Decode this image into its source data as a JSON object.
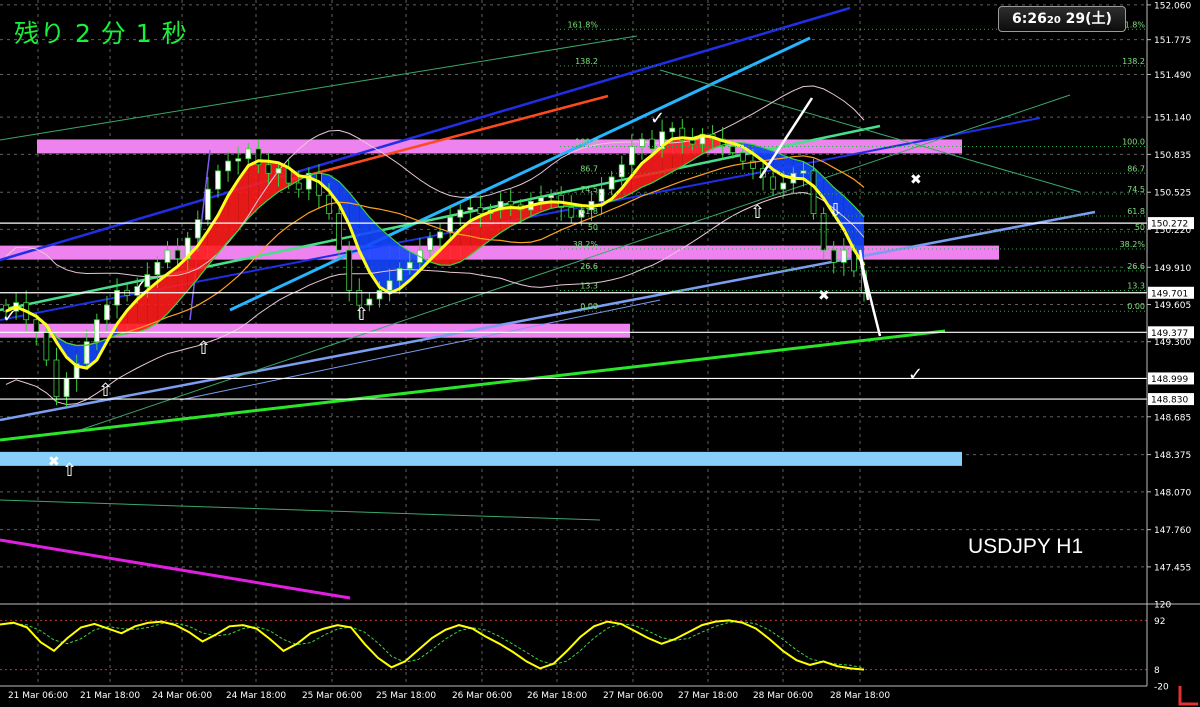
{
  "overlay": {
    "countdown": "残り 2 分 1 秒",
    "clock_time": "6:26",
    "clock_seconds": "20",
    "clock_date": "29(土)",
    "symbol_label": "USDJPY H1"
  },
  "colors": {
    "background": "#000000",
    "grid": "#5f5f5f",
    "candle_body": "#ffffff",
    "candle_wick": "#3cd23c",
    "cloud_bull": "#ff1c1c",
    "cloud_bear": "#1446ff",
    "sma_fast": "#ffff1e",
    "oscillator": "#ffff00",
    "zone_pink": "#ee82ee",
    "zone_blue": "#87cefa",
    "countdown_text": "#19f03c"
  },
  "chart_data": [
    {
      "type": "candlestick",
      "symbol": "USDJPY",
      "timeframe": "H1",
      "ylim": [
        147.2,
        152.1
      ],
      "y_ticks": [
        "152.060",
        "151.775",
        "151.490",
        "151.140",
        "150.835",
        "150.525",
        "150.220",
        "149.910",
        "149.605",
        "149.300",
        "148.685",
        "148.375",
        "148.070",
        "147.760",
        "147.455"
      ],
      "x_ticks": [
        "21 Mar 06:00",
        "21 Mar 18:00",
        "24 Mar 06:00",
        "24 Mar 18:00",
        "25 Mar 06:00",
        "25 Mar 18:00",
        "26 Mar 06:00",
        "26 Mar 18:00",
        "27 Mar 06:00",
        "27 Mar 18:00",
        "28 Mar 06:00",
        "28 Mar 18:00"
      ],
      "price_markers": [
        {
          "label": "150.272",
          "price": 150.272
        },
        {
          "label": "149.701",
          "price": 149.701
        },
        {
          "label": "149.377",
          "price": 149.377
        },
        {
          "label": "148.999",
          "price": 148.999
        },
        {
          "label": "148.830",
          "price": 148.83
        }
      ],
      "fib_levels": [
        {
          "label": "161.8%",
          "price": 151.86
        },
        {
          "label": "138.2",
          "price": 151.56
        },
        {
          "label": "100.0",
          "price": 150.9
        },
        {
          "label": "86.7",
          "price": 150.68
        },
        {
          "label": "74.5",
          "price": 150.51
        },
        {
          "label": "61.8",
          "price": 150.33
        },
        {
          "label": "50",
          "price": 150.2
        },
        {
          "label": "38.2%",
          "price": 150.06
        },
        {
          "label": "26.6",
          "price": 149.88
        },
        {
          "label": "13.3",
          "price": 149.72
        },
        {
          "label": "0.00",
          "price": 149.55
        }
      ],
      "closes": [
        149.55,
        149.62,
        149.48,
        149.38,
        149.15,
        148.85,
        149.0,
        149.12,
        149.3,
        149.48,
        149.6,
        149.72,
        149.68,
        149.75,
        149.85,
        149.95,
        150.05,
        149.98,
        150.15,
        150.3,
        150.55,
        150.7,
        150.78,
        150.8,
        150.88,
        150.75,
        150.68,
        150.72,
        150.6,
        150.55,
        150.68,
        150.5,
        150.35,
        150.05,
        149.72,
        149.6,
        149.65,
        149.72,
        149.8,
        149.9,
        149.95,
        150.05,
        150.15,
        150.2,
        150.32,
        150.38,
        150.4,
        150.35,
        150.38,
        150.45,
        150.42,
        150.38,
        150.45,
        150.48,
        150.5,
        150.4,
        150.32,
        150.38,
        150.45,
        150.55,
        150.65,
        150.75,
        150.9,
        150.96,
        150.88,
        151.02,
        151.05,
        150.95,
        150.92,
        151.0,
        150.96,
        150.9,
        150.85,
        150.78,
        150.72,
        150.65,
        150.55,
        150.6,
        150.68,
        150.7,
        150.35,
        150.05,
        149.95,
        150.05,
        149.88,
        149.7
      ],
      "oscillator": {
        "levels": [
          "120",
          "92",
          "8",
          "-20"
        ],
        "values": [
          85,
          88,
          80,
          55,
          40,
          62,
          80,
          86,
          78,
          70,
          82,
          88,
          90,
          84,
          72,
          56,
          68,
          82,
          84,
          78,
          60,
          40,
          52,
          70,
          78,
          84,
          80,
          52,
          28,
          12,
          22,
          42,
          62,
          76,
          84,
          78,
          64,
          52,
          38,
          22,
          10,
          18,
          40,
          64,
          82,
          90,
          86,
          74,
          62,
          52,
          60,
          72,
          84,
          90,
          92,
          88,
          78,
          60,
          40,
          24,
          16,
          22,
          14,
          10,
          8
        ]
      }
    }
  ]
}
